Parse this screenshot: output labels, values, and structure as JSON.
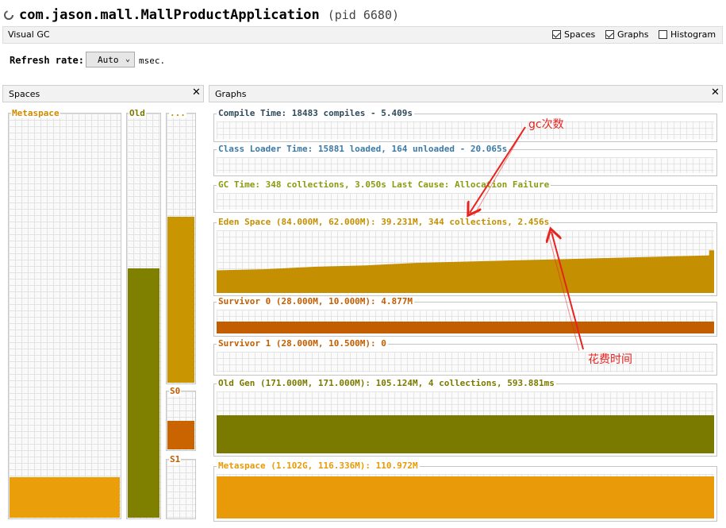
{
  "app": {
    "title": "com.jason.mall.MallProductApplication",
    "pid": "(pid 6680)"
  },
  "toolbar": {
    "tab_label": "Visual GC",
    "checkboxes": [
      {
        "label": "Spaces",
        "checked": true
      },
      {
        "label": "Graphs",
        "checked": true
      },
      {
        "label": "Histogram",
        "checked": false
      }
    ]
  },
  "refresh": {
    "label": "Refresh rate:",
    "value": "Auto",
    "unit": "msec."
  },
  "spaces_panel": {
    "title": "Spaces",
    "columns": [
      {
        "label": "Metaspace",
        "fill": 0.1,
        "color": "#ea9f0a"
      },
      {
        "label": "Old",
        "fill": 0.615,
        "color": "#808000"
      },
      {
        "label": "...",
        "fill": 0.615,
        "color": "#c99500"
      },
      {
        "label": "S0",
        "fill": 0.49,
        "color": "#c96400"
      },
      {
        "label": "S1",
        "fill": 0.0,
        "color": "#c96400"
      }
    ]
  },
  "graphs_panel": {
    "title": "Graphs",
    "rows": [
      {
        "label": "Compile Time: 18483 compiles - 5.409s",
        "color": "#2f4a5a",
        "fill": 0
      },
      {
        "label": "Class Loader Time: 15881 loaded, 164 unloaded - 20.065s",
        "color": "#3a7aa8",
        "fill": 0
      },
      {
        "label": "GC Time: 348 collections, 3.050s  Last Cause: Allocation Failure",
        "color": "#8a9a10",
        "fill": 0
      },
      {
        "label": "Eden Space (84.000M, 62.000M): 39.231M, 344 collections, 2.456s",
        "color": "#c48f00",
        "fill": 0.6
      },
      {
        "label": "Survivor 0 (28.000M, 10.000M): 4.877M",
        "color": "#c25d00",
        "fill": 0.5
      },
      {
        "label": "Survivor 1 (28.000M, 10.500M): 0",
        "color": "#c25d00",
        "fill": 0
      },
      {
        "label": "Old Gen (171.000M, 171.000M): 105.124M, 4 collections, 593.881ms",
        "color": "#7a7a00",
        "fill": 0.62
      },
      {
        "label": "Metaspace (1.102G, 116.336M): 110.972M",
        "color": "#e89a08",
        "fill": 0.95
      }
    ]
  },
  "annotations": {
    "gc_count": "gc次数",
    "time_spent": "花费时间",
    "color": "#e8231f"
  }
}
